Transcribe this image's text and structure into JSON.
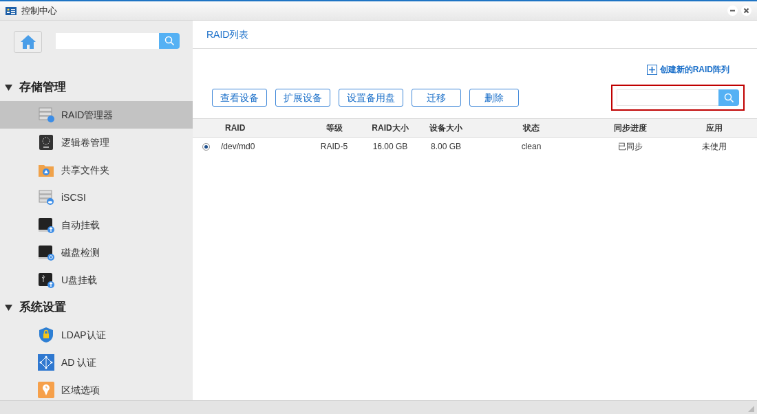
{
  "window": {
    "title": "控制中心"
  },
  "sidebar": {
    "sections": [
      {
        "label": "存储管理",
        "expanded": true,
        "items": [
          {
            "label": "RAID管理器",
            "selected": true
          },
          {
            "label": "逻辑卷管理",
            "selected": false
          },
          {
            "label": "共享文件夹",
            "selected": false
          },
          {
            "label": "iSCSI",
            "selected": false
          },
          {
            "label": "自动挂载",
            "selected": false
          },
          {
            "label": "磁盘检测",
            "selected": false
          },
          {
            "label": "U盘挂载",
            "selected": false
          }
        ]
      },
      {
        "label": "系统设置",
        "expanded": true,
        "items": [
          {
            "label": "LDAP认证",
            "selected": false
          },
          {
            "label": "AD 认证",
            "selected": false
          },
          {
            "label": "区域选项",
            "selected": false
          }
        ]
      }
    ]
  },
  "tabs": [
    {
      "label": "RAID列表",
      "selected": true
    }
  ],
  "create_link": "创建新的RAID阵列",
  "buttons": [
    "查看设备",
    "扩展设备",
    "设置备用盘",
    "迁移",
    "删除"
  ],
  "table": {
    "columns": [
      "RAID",
      "等级",
      "RAID大小",
      "设备大小",
      "状态",
      "同步进度",
      "应用"
    ],
    "rows": [
      {
        "selected": true,
        "cells": [
          "/dev/md0",
          "RAID-5",
          "16.00 GB",
          "8.00 GB",
          "clean",
          "已同步",
          "未使用"
        ]
      }
    ]
  }
}
